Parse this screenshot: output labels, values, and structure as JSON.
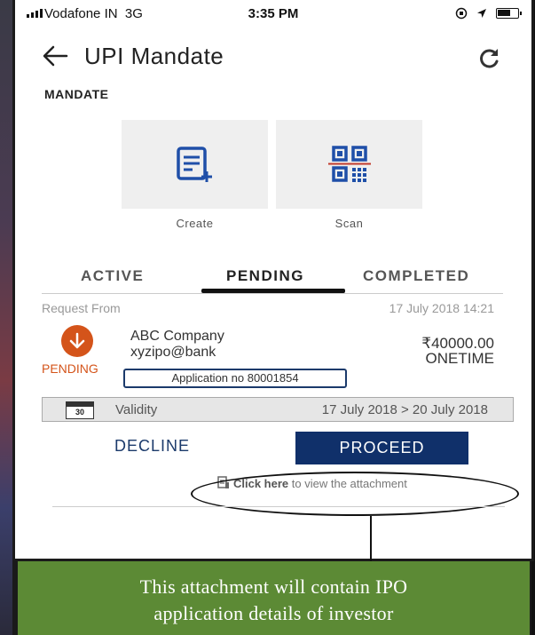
{
  "status_bar": {
    "carrier": "Vodafone IN",
    "network": "3G",
    "time": "3:35 PM"
  },
  "header": {
    "title": "UPI Mandate",
    "back_icon": "back-arrow-icon",
    "refresh_icon": "refresh-icon"
  },
  "section_label": "MANDATE",
  "actions": [
    {
      "label": "Create",
      "icon": "create-mandate-icon"
    },
    {
      "label": "Scan",
      "icon": "qr-scan-icon"
    }
  ],
  "tabs": [
    {
      "label": "ACTIVE",
      "active": false
    },
    {
      "label": "PENDING",
      "active": true
    },
    {
      "label": "COMPLETED",
      "active": false
    }
  ],
  "request": {
    "label": "Request From",
    "date": "17 July 2018 14:21",
    "status": "PENDING",
    "payee_name": "ABC Company",
    "payee_vpa": "xyzipo@bank",
    "amount": "₹40000.00",
    "frequency": "ONETIME",
    "application_no": "Application no 80001854"
  },
  "validity": {
    "calendar_day": "30",
    "label": "Validity",
    "range": "17 July 2018 > 20 July 2018"
  },
  "buttons": {
    "decline": "DECLINE",
    "proceed": "PROCEED"
  },
  "attachment": {
    "link": "Click here",
    "suffix": "to view the attachment"
  },
  "callout": {
    "line1": "This attachment will contain IPO",
    "line2": "application details of investor"
  },
  "colors": {
    "primary": "#10306a",
    "pending": "#d4541a",
    "callout_bg": "#5c8a35"
  }
}
